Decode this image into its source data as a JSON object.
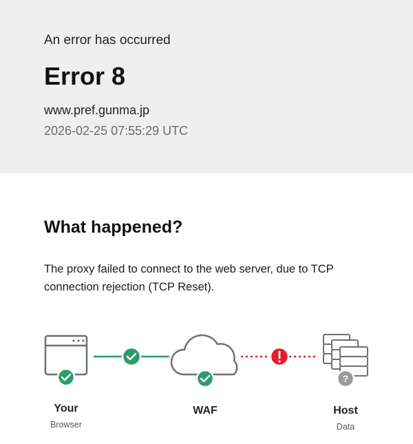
{
  "header": {
    "subtitle": "An error has occurred",
    "title": "Error 8",
    "host": "www.pref.gunma.jp",
    "timestamp": "2026-02-25 07:55:29 UTC"
  },
  "main": {
    "heading": "What happened?",
    "description": "The proxy failed to connect to the web server, due to TCP connection rejection (TCP Reset)."
  },
  "diagram": {
    "nodes": [
      {
        "label": "Your",
        "sublabel": "Browser",
        "icon": "browser-window-icon",
        "status": "ok"
      },
      {
        "label": "WAF",
        "sublabel": "",
        "icon": "cloud-icon",
        "status": "ok"
      },
      {
        "label": "Host",
        "sublabel": "Data",
        "icon": "server-stack-icon",
        "status": "unknown"
      }
    ],
    "links": [
      {
        "status": "ok",
        "icon": "check-icon"
      },
      {
        "status": "error",
        "icon": "exclamation-icon"
      }
    ],
    "colors": {
      "ok": "#2e9b6a",
      "error": "#e0202a",
      "unknown": "#9a9a9a",
      "line_ok": "#2e9b6a",
      "line_error": "#e0202a"
    }
  }
}
